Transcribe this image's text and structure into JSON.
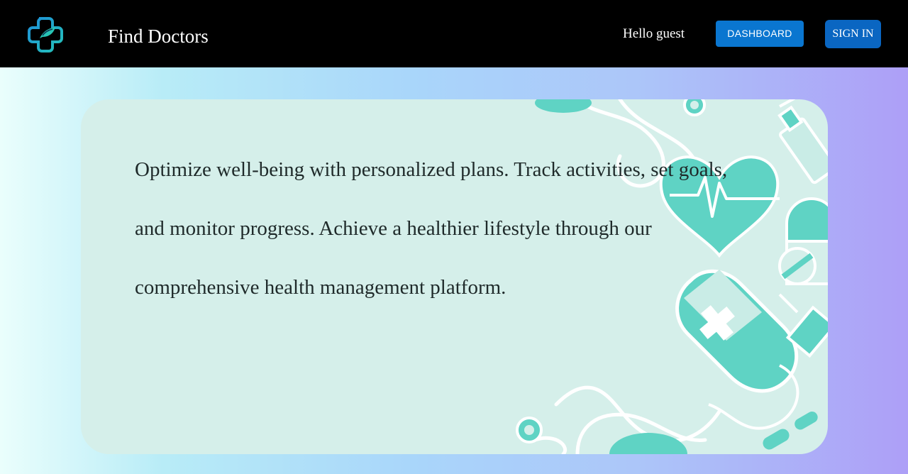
{
  "header": {
    "brand": "Find Doctors",
    "greeting": "Hello guest",
    "dashboard_label": "DASHBOARD",
    "signin_label": "SIGN IN"
  },
  "hero": {
    "text": "Optimize well-being with personalized plans. Track activities, set goals, and monitor progress. Achieve a healthier lifestyle through our comprehensive health management platform."
  },
  "icons": {
    "logo": "medical-cross-logo-icon",
    "art": [
      "stethoscope-icon",
      "heart-pulse-icon",
      "iv-bag-cross-icon",
      "pill-capsule-icon",
      "syringe-icon"
    ]
  },
  "colors": {
    "navbar": "#000000",
    "dashboard_button": "#0a76d0",
    "signin_button": "#0a66c2",
    "accent_teal": "#5fd3c4",
    "card_bg": "#d5efea"
  }
}
